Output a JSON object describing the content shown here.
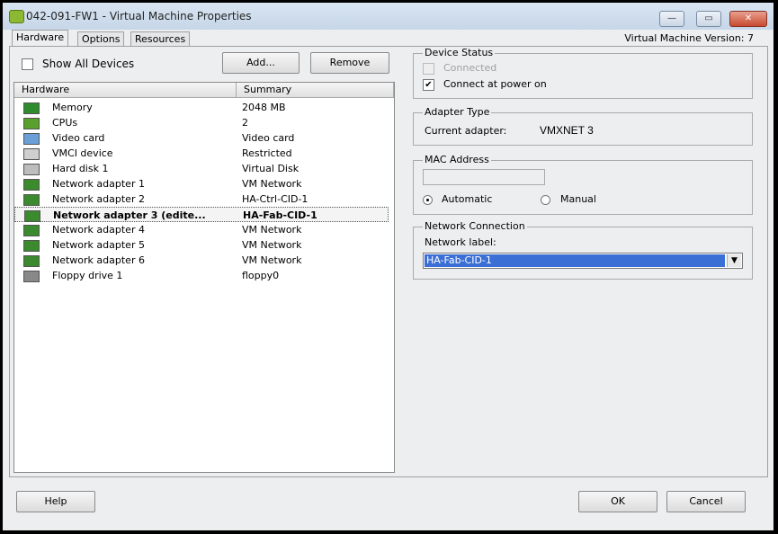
{
  "window": {
    "title": "042-091-FW1 - Virtual Machine Properties",
    "minimize": "—",
    "maximize": "▭",
    "close": "✕"
  },
  "tabs": [
    {
      "label": "Hardware"
    },
    {
      "label": "Options"
    },
    {
      "label": "Resources"
    }
  ],
  "vm_version": "Virtual Machine Version: 7",
  "show_all_devices": {
    "label": "Show All Devices",
    "checked": false
  },
  "add_label": "Add...",
  "remove_label": "Remove",
  "list": {
    "columns": [
      "Hardware",
      "Summary"
    ],
    "rows": [
      {
        "name": "Memory",
        "summary": "2048 MB",
        "icon": "memory-icon"
      },
      {
        "name": "CPUs",
        "summary": "2",
        "icon": "cpu-icon"
      },
      {
        "name": "Video card",
        "summary": "Video card",
        "icon": "monitor-icon"
      },
      {
        "name": "VMCI device",
        "summary": "Restricted",
        "icon": "vmci-icon"
      },
      {
        "name": "Hard disk 1",
        "summary": "Virtual Disk",
        "icon": "disk-icon"
      },
      {
        "name": "Network adapter 1",
        "summary": "VM Network",
        "icon": "nic-icon"
      },
      {
        "name": "Network adapter 2",
        "summary": "HA-Ctrl-CID-1",
        "icon": "nic-icon"
      },
      {
        "name": "Network adapter 3 (edite...",
        "summary": "HA-Fab-CID-1",
        "icon": "nic-icon",
        "selected": true
      },
      {
        "name": "Network adapter 4",
        "summary": "VM Network",
        "icon": "nic-icon"
      },
      {
        "name": "Network adapter 5",
        "summary": "VM Network",
        "icon": "nic-icon"
      },
      {
        "name": "Network adapter 6",
        "summary": "VM Network",
        "icon": "nic-icon"
      },
      {
        "name": "Floppy drive 1",
        "summary": "floppy0",
        "icon": "floppy-icon"
      }
    ]
  },
  "device_status": {
    "title": "Device Status",
    "connected": "Connected",
    "connect_power_on": "Connect at power on",
    "power_on_checked": true
  },
  "adapter_type": {
    "title": "Adapter Type",
    "label": "Current adapter:",
    "value": "VMXNET 3"
  },
  "mac": {
    "title": "MAC Address",
    "value": "",
    "automatic": "Automatic",
    "manual": "Manual",
    "selected": "Automatic"
  },
  "network": {
    "title": "Network Connection",
    "label": "Network label:",
    "value": "HA-Fab-CID-1"
  },
  "footer": {
    "help": "Help",
    "ok": "OK",
    "cancel": "Cancel"
  }
}
